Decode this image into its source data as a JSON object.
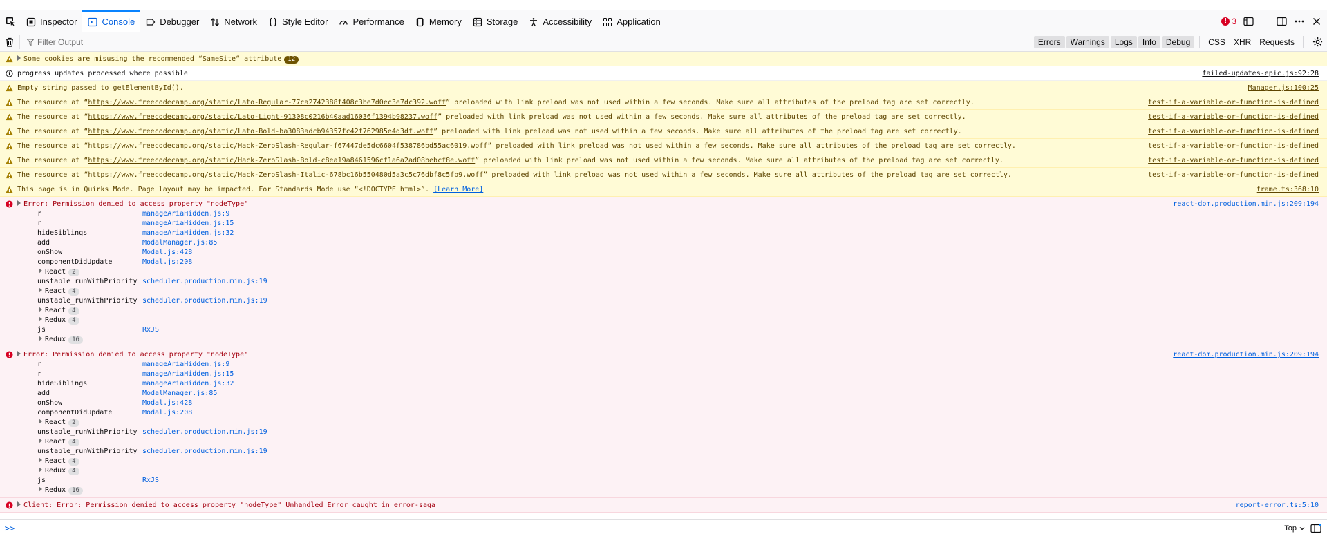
{
  "tabs": [
    {
      "label": "Inspector",
      "icon": "inspector-icon"
    },
    {
      "label": "Console",
      "icon": "console-icon"
    },
    {
      "label": "Debugger",
      "icon": "debugger-icon"
    },
    {
      "label": "Network",
      "icon": "network-icon"
    },
    {
      "label": "Style Editor",
      "icon": "style-editor-icon"
    },
    {
      "label": "Performance",
      "icon": "performance-icon"
    },
    {
      "label": "Memory",
      "icon": "memory-icon"
    },
    {
      "label": "Storage",
      "icon": "storage-icon"
    },
    {
      "label": "Accessibility",
      "icon": "accessibility-icon"
    },
    {
      "label": "Application",
      "icon": "application-icon"
    }
  ],
  "selected_tab": "Console",
  "error_count": "3",
  "filter": {
    "placeholder": "Filter Output"
  },
  "levels": {
    "errors": "Errors",
    "warnings": "Warnings",
    "logs": "Logs",
    "info": "Info",
    "debug": "Debug"
  },
  "kinds": {
    "css": "CSS",
    "xhr": "XHR",
    "requests": "Requests"
  },
  "colors": {
    "accent": "#0a84ff",
    "error": "#d70022",
    "warning_bg": "#fffbd6",
    "error_bg": "#fdf2f5"
  },
  "messages": {
    "m0": {
      "text": "Some cookies are misusing the recommended “SameSite“ attribute",
      "badge": "12"
    },
    "m1": {
      "text": "progress updates processed where possible",
      "loc": "failed-updates-epic.js:92:28"
    },
    "m2": {
      "text": "Empty string passed to getElementById().",
      "loc": "Manager.js:100:25"
    },
    "m3": {
      "pre": "The resource at “",
      "url": "https://www.freecodecamp.org/static/Lato-Regular-77ca2742388f408c3be7d0ec3e7dc392.woff",
      "post": "” preloaded with link preload was not used within a few seconds. Make sure all attributes of the preload tag are set correctly.",
      "loc": "test-if-a-variable-or-function-is-defined"
    },
    "m4": {
      "pre": "The resource at “",
      "url": "https://www.freecodecamp.org/static/Lato-Light-91308c0216b40aad16036f1394b98237.woff",
      "post": "” preloaded with link preload was not used within a few seconds. Make sure all attributes of the preload tag are set correctly.",
      "loc": "test-if-a-variable-or-function-is-defined"
    },
    "m5": {
      "pre": "The resource at “",
      "url": "https://www.freecodecamp.org/static/Lato-Bold-ba3083adcb94357fc42f762985e4d3df.woff",
      "post": "” preloaded with link preload was not used within a few seconds. Make sure all attributes of the preload tag are set correctly.",
      "loc": "test-if-a-variable-or-function-is-defined"
    },
    "m6": {
      "pre": "The resource at “",
      "url": "https://www.freecodecamp.org/static/Hack-ZeroSlash-Regular-f67447de5dc6604f538786bd55ac6019.woff",
      "post": "” preloaded with link preload was not used within a few seconds. Make sure all attributes of the preload tag are set correctly.",
      "loc": "test-if-a-variable-or-function-is-defined"
    },
    "m7": {
      "pre": "The resource at “",
      "url": "https://www.freecodecamp.org/static/Hack-ZeroSlash-Bold-c8ea19a8461596cf1a6a2ad08bebcf8e.woff",
      "post": "” preloaded with link preload was not used within a few seconds. Make sure all attributes of the preload tag are set correctly.",
      "loc": "test-if-a-variable-or-function-is-defined"
    },
    "m8": {
      "pre": "The resource at “",
      "url": "https://www.freecodecamp.org/static/Hack-ZeroSlash-Italic-678bc16b550480d5a3c5c76dbf8c5fb9.woff",
      "post": "” preloaded with link preload was not used within a few seconds. Make sure all attributes of the preload tag are set correctly.",
      "loc": "test-if-a-variable-or-function-is-defined"
    },
    "m9": {
      "text": "This page is in Quirks Mode. Page layout may be impacted. For Standards Mode use “<!DOCTYPE html>”. ",
      "link": "[Learn More]",
      "loc": "frame.ts:368:10"
    },
    "e1": {
      "text": "Error: Permission denied to access property \"nodeType\"",
      "loc": "react-dom.production.min.js:209:194"
    },
    "e2": {
      "text": "Error: Permission denied to access property \"nodeType\"",
      "loc": "react-dom.production.min.js:209:194"
    },
    "e3": {
      "text": "Client: Error: Permission denied to access property \"nodeType\" Unhandled Error caught in error-saga",
      "loc": "report-error.ts:5:10"
    }
  },
  "stack": {
    "f0": {
      "fn": "r",
      "src": "manageAriaHidden.js:9"
    },
    "f1": {
      "fn": "r",
      "src": "manageAriaHidden.js:15"
    },
    "f2": {
      "fn": "hideSiblings",
      "src": "manageAriaHidden.js:32"
    },
    "f3": {
      "fn": "add",
      "src": "ModalManager.js:85"
    },
    "f4": {
      "fn": "onShow",
      "src": "Modal.js:428"
    },
    "f5": {
      "fn": "componentDidUpdate",
      "src": "Modal.js:208"
    },
    "g6": {
      "label": "React",
      "count": "2"
    },
    "f7": {
      "fn": "unstable_runWithPriority",
      "src": "scheduler.production.min.js:19"
    },
    "g8": {
      "label": "React",
      "count": "4"
    },
    "f9": {
      "fn": "unstable_runWithPriority",
      "src": "scheduler.production.min.js:19"
    },
    "g10": {
      "label": "React",
      "count": "4"
    },
    "g11": {
      "label": "Redux",
      "count": "4"
    },
    "f12": {
      "fn": "js",
      "src": "RxJS"
    },
    "g13": {
      "label": "Redux",
      "count": "16"
    }
  },
  "console": {
    "prompt": ">>",
    "context": "Top"
  }
}
